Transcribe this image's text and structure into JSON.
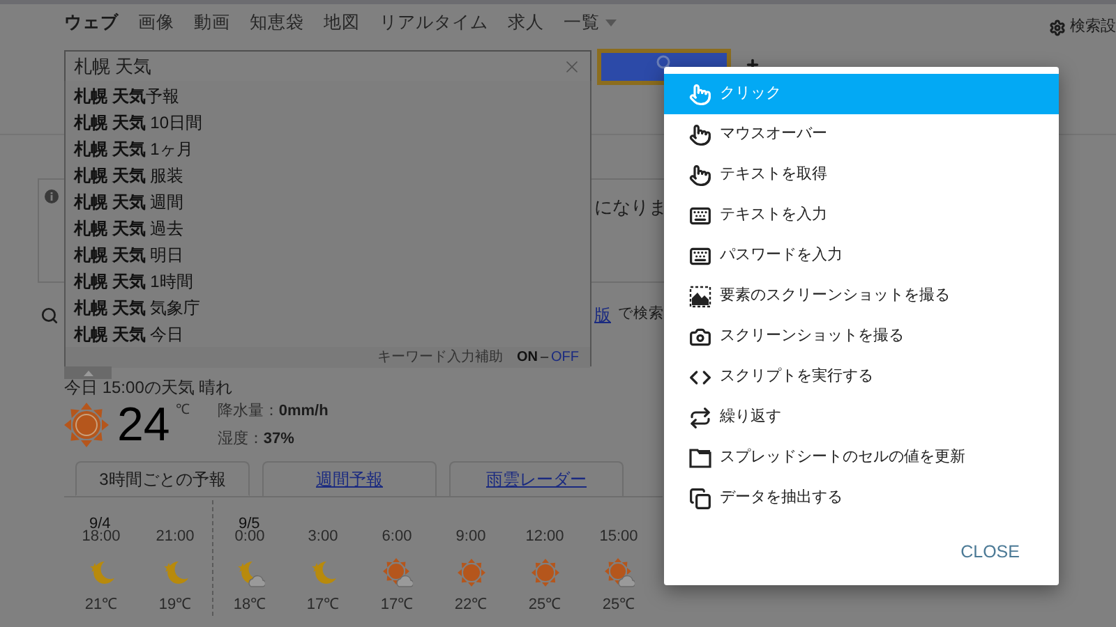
{
  "nav": {
    "tabs": [
      {
        "label": "ウェブ",
        "selected": true
      },
      {
        "label": "画像",
        "selected": false
      },
      {
        "label": "動画",
        "selected": false
      },
      {
        "label": "知恵袋",
        "selected": false
      },
      {
        "label": "地図",
        "selected": false
      },
      {
        "label": "リアルタイム",
        "selected": false
      },
      {
        "label": "求人",
        "selected": false
      }
    ],
    "more": "一覧",
    "settings": "検索設"
  },
  "search": {
    "value": "札幌 天気",
    "suggestions": [
      "**札幌 天気**予報",
      "**札幌 天気** 10日間",
      "**札幌 天気** 1ヶ月",
      "**札幌 天気** 服装",
      "**札幌 天気** 週間",
      "**札幌 天気** 過去",
      "**札幌 天気** 明日",
      "**札幌 天気** 1時間",
      "**札幌 天気** 気象庁",
      "**札幌 天気** 今日"
    ],
    "assist_label": "キーワード入力補助",
    "assist_on": "ON",
    "assist_sep": "–",
    "assist_off": "OFF"
  },
  "notice": {
    "text": "になりま"
  },
  "alt_search": {
    "link": "版",
    "text": "で検索"
  },
  "weather": {
    "heading": "今日 15:00の天気 晴れ",
    "temperature": "24",
    "unit": "℃",
    "precip_label": "降水量：",
    "precip": "0mm/h",
    "humidity_label": "湿度：",
    "humidity": "37%",
    "tabs": [
      {
        "label": "3時間ごとの予報",
        "selected": true
      },
      {
        "label": "週間予報",
        "selected": false
      },
      {
        "label": "雨雲レーダー",
        "selected": false
      }
    ],
    "hours": [
      {
        "date": "9/4",
        "time": "18:00",
        "kind": "moon",
        "temp": "21℃"
      },
      {
        "time": "21:00",
        "kind": "moon",
        "temp": "19℃"
      },
      {
        "date": "9/5",
        "time": "0:00",
        "kind": "moon-cloud",
        "temp": "18℃"
      },
      {
        "time": "3:00",
        "kind": "moon",
        "temp": "17℃"
      },
      {
        "time": "6:00",
        "kind": "sun-cloud",
        "temp": "17℃"
      },
      {
        "time": "9:00",
        "kind": "sun",
        "temp": "22℃"
      },
      {
        "time": "12:00",
        "kind": "sun",
        "temp": "25℃"
      },
      {
        "time": "15:00",
        "kind": "sun-cloud",
        "temp": "25℃"
      }
    ]
  },
  "menu": {
    "items": [
      {
        "label": "クリック",
        "kind": "pointer",
        "selected": true
      },
      {
        "label": "マウスオーバー",
        "kind": "pointer",
        "selected": false
      },
      {
        "label": "テキストを取得",
        "kind": "pointer",
        "selected": false
      },
      {
        "label": "テキストを入力",
        "kind": "keyboard",
        "selected": false
      },
      {
        "label": "パスワードを入力",
        "kind": "keyboard",
        "selected": false
      },
      {
        "label": "要素のスクリーンショットを撮る",
        "kind": "element-shot",
        "selected": false
      },
      {
        "label": "スクリーンショットを撮る",
        "kind": "camera",
        "selected": false
      },
      {
        "label": "スクリプトを実行する",
        "kind": "code",
        "selected": false
      },
      {
        "label": "繰り返す",
        "kind": "repeat",
        "selected": false
      },
      {
        "label": "スプレッドシートのセルの値を更新",
        "kind": "sheet",
        "selected": false
      },
      {
        "label": "データを抽出する",
        "kind": "copy",
        "selected": false
      }
    ],
    "close": "CLOSE"
  }
}
